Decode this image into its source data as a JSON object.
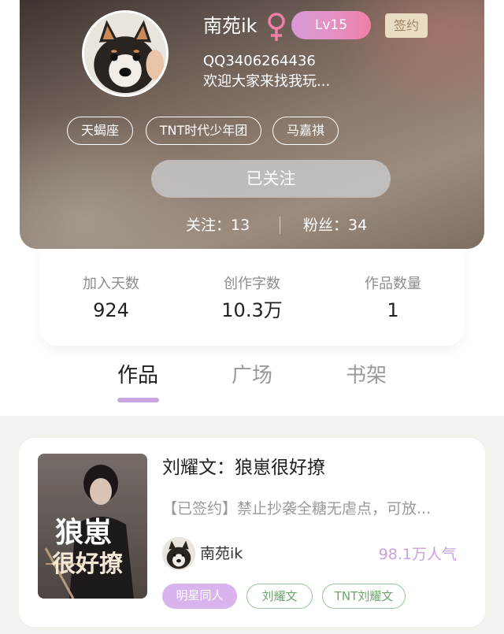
{
  "profile": {
    "username": "南苑ik",
    "level": "Lv15",
    "sign_badge": "签约",
    "qq": "QQ3406264436",
    "bio": "欢迎大家来找我玩...",
    "tags": [
      "天蝎座",
      "TNT时代少年团",
      "马嘉祺"
    ],
    "follow_button": "已关注",
    "following": "关注：13",
    "fans": "粉丝：34",
    "gender_icon": "female-symbol-icon"
  },
  "stats": [
    {
      "label": "加入天数",
      "value": "924"
    },
    {
      "label": "创作字数",
      "value": "10.3万"
    },
    {
      "label": "作品数量",
      "value": "1"
    }
  ],
  "tabs": [
    "作品",
    "广场",
    "书架"
  ],
  "active_tab": "作品",
  "work": {
    "title": "刘耀文：狼崽很好撩",
    "description": "【已签约】禁止抄袭全糖无虐点，可放...",
    "author": "南苑ik",
    "popularity": "98.1万人气",
    "cover_title_line1": "狼崽",
    "cover_title_line2": "很好撩",
    "tags": [
      "明星同人",
      "刘耀文",
      "TNT刘耀文"
    ]
  },
  "colors": {
    "accent_purple": "#c9a6e4",
    "level_badge": "#e58fc0",
    "tag_green": "#6fa56f",
    "sign_badge_bg": "#e9dcc2"
  }
}
